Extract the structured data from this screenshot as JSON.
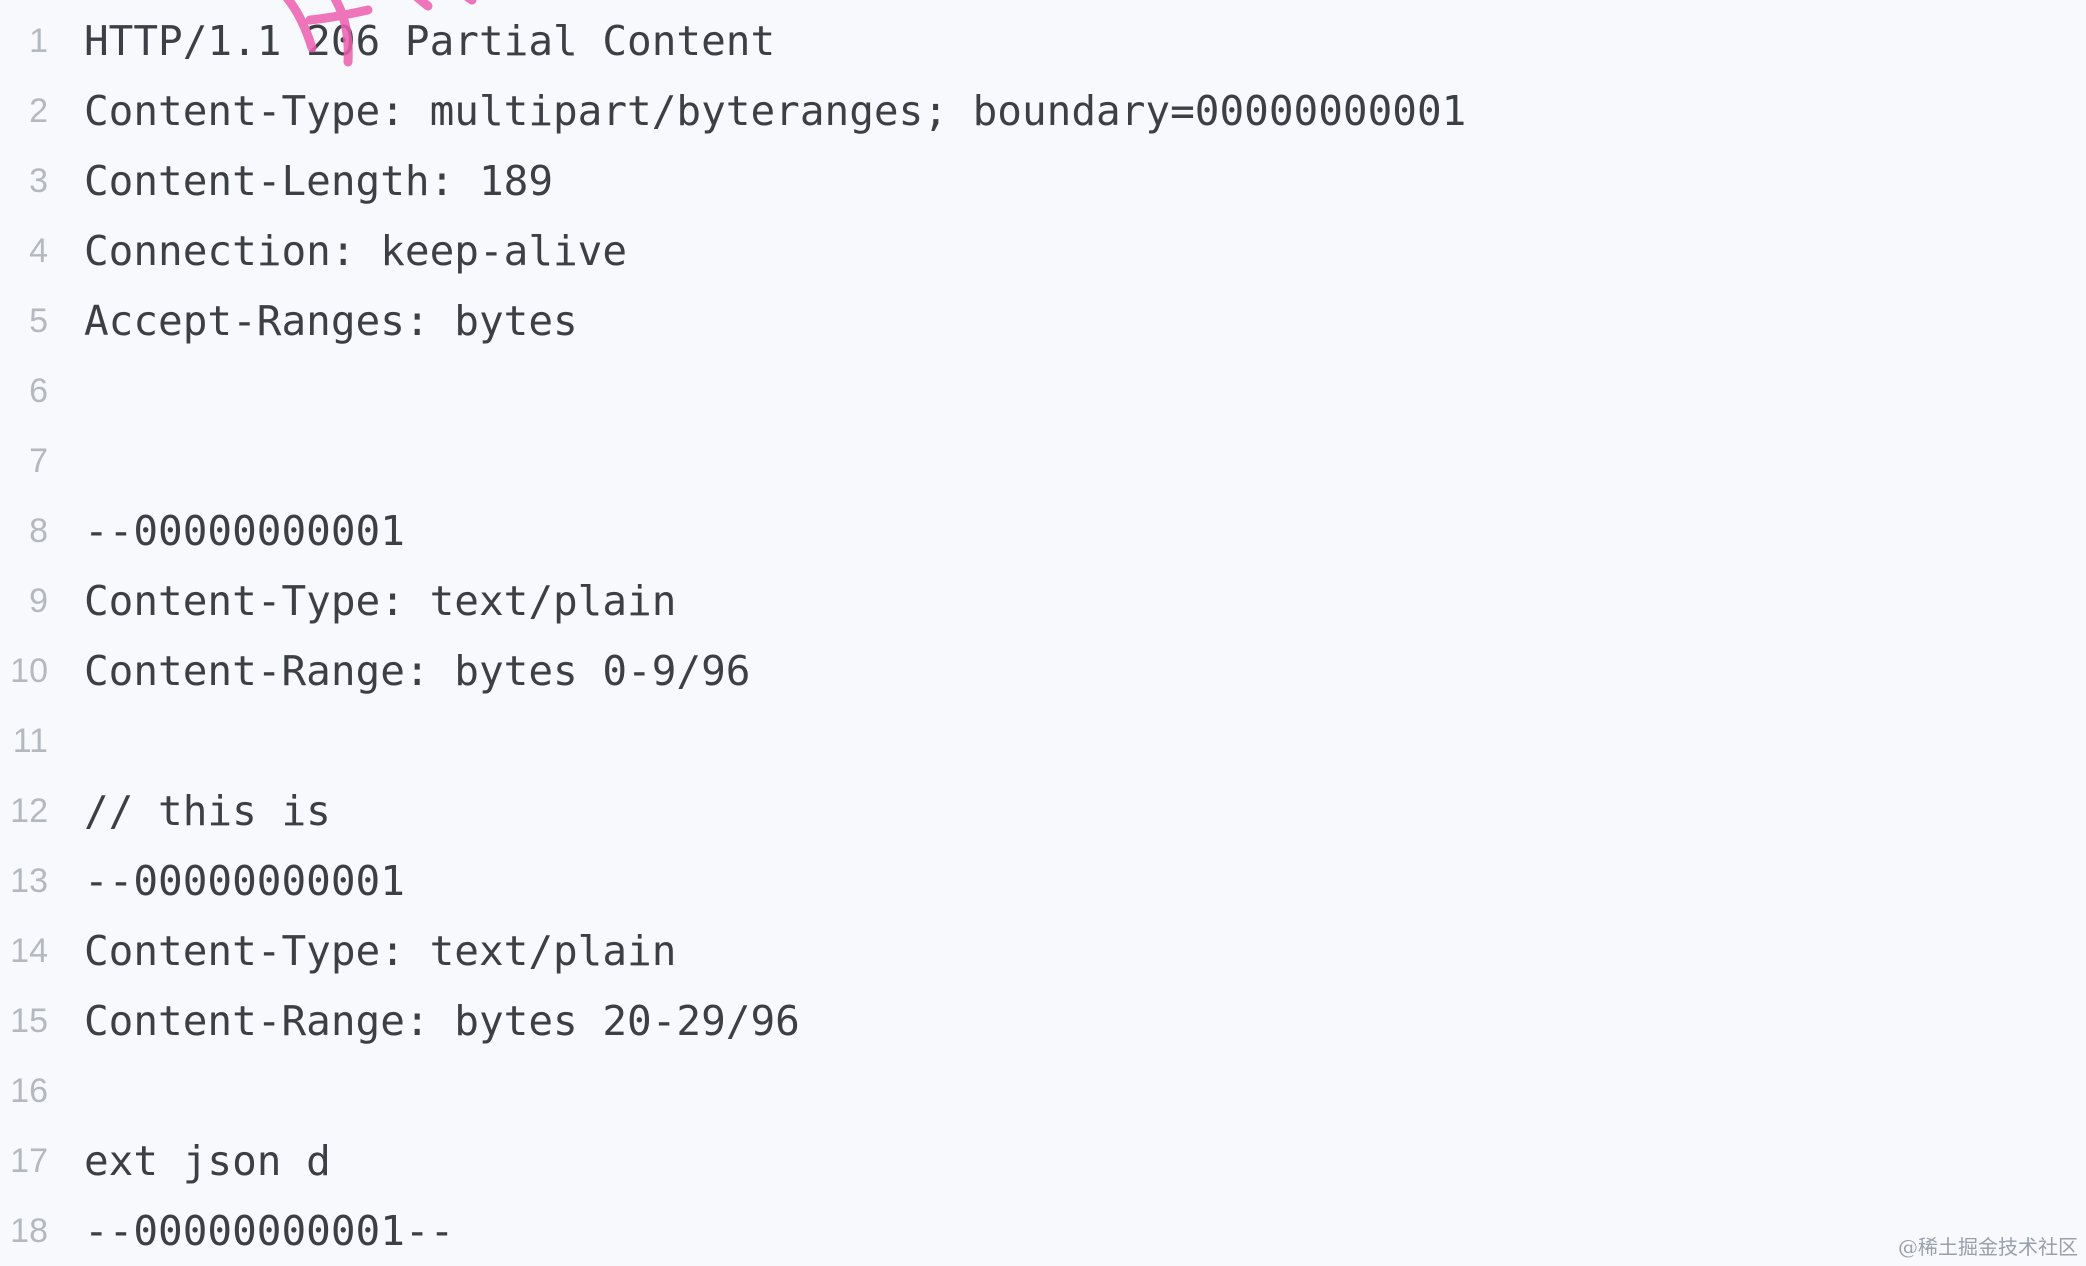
{
  "code": {
    "lines": [
      {
        "number": "1",
        "text": "HTTP/1.1 206 Partial Content"
      },
      {
        "number": "2",
        "text": "Content-Type: multipart/byteranges; boundary=00000000001"
      },
      {
        "number": "3",
        "text": "Content-Length: 189"
      },
      {
        "number": "4",
        "text": "Connection: keep-alive"
      },
      {
        "number": "5",
        "text": "Accept-Ranges: bytes"
      },
      {
        "number": "6",
        "text": ""
      },
      {
        "number": "7",
        "text": ""
      },
      {
        "number": "8",
        "text": "--00000000001"
      },
      {
        "number": "9",
        "text": "Content-Type: text/plain"
      },
      {
        "number": "10",
        "text": "Content-Range: bytes 0-9/96"
      },
      {
        "number": "11",
        "text": ""
      },
      {
        "number": "12",
        "text": "// this is"
      },
      {
        "number": "13",
        "text": "--00000000001"
      },
      {
        "number": "14",
        "text": "Content-Type: text/plain"
      },
      {
        "number": "15",
        "text": "Content-Range: bytes 20-29/96"
      },
      {
        "number": "16",
        "text": ""
      },
      {
        "number": "17",
        "text": "ext json d"
      },
      {
        "number": "18",
        "text": "--00000000001--"
      }
    ]
  },
  "annotation": {
    "color": "#ee5fb0"
  },
  "watermark": {
    "text": "@稀土掘金技术社区"
  }
}
